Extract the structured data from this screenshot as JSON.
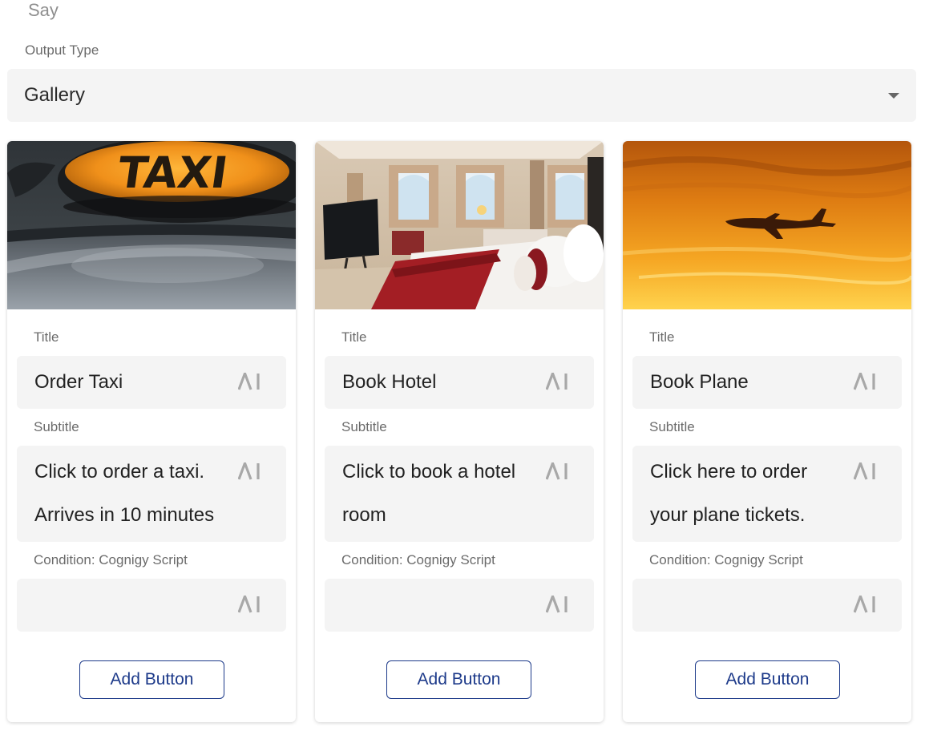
{
  "say_label": "Say",
  "output_type": {
    "label": "Output Type",
    "value": "Gallery"
  },
  "field_labels": {
    "title": "Title",
    "subtitle": "Subtitle",
    "condition": "Condition: Cognigy Script"
  },
  "cards": [
    {
      "image": "taxi-sign-photo",
      "title": "Order Taxi",
      "subtitle_line1": "Click to order a taxi.",
      "subtitle_line2": "Arrives in 10 minutes",
      "condition": "",
      "button_label": "Add Button"
    },
    {
      "image": "hotel-room-photo",
      "title": "Book Hotel",
      "subtitle_line1": "Click to book a hotel",
      "subtitle_line2": "room",
      "condition": "",
      "button_label": "Add Button"
    },
    {
      "image": "airplane-sunset-photo",
      "title": "Book Plane",
      "subtitle_line1": "Click here to order",
      "subtitle_line2": "your plane tickets.",
      "condition": "",
      "button_label": "Add Button"
    }
  ],
  "colors": {
    "field_background": "#f4f4f4",
    "button_accent": "#1d3a8a",
    "label_gray": "#6b6b6b"
  }
}
